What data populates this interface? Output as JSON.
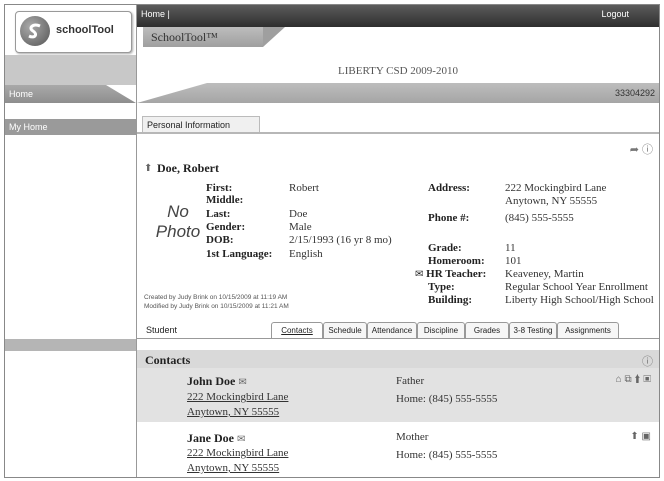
{
  "logo": {
    "text": "schoolTool"
  },
  "topbar": {
    "home": "Home |",
    "logout": "Logout"
  },
  "app_tab": "SchoolTool™",
  "district": "LIBERTY CSD 2009-2010",
  "id_number": "33304292",
  "left_nav": {
    "home_tab": "Home",
    "my_home": "My Home"
  },
  "personal_info_tab": "Personal Information",
  "student": {
    "display_name": "Doe, Robert",
    "no_photo": [
      "No",
      "Photo"
    ],
    "fields": [
      {
        "label": "First:",
        "value": "Robert"
      },
      {
        "label": "Middle:",
        "value": ""
      },
      {
        "label": "Last:",
        "value": "Doe"
      },
      {
        "label": "Gender:",
        "value": "Male"
      },
      {
        "label": "DOB:",
        "value": "2/15/1993 (16 yr 8 mo)"
      },
      {
        "label": "1st Language:",
        "value": "English"
      }
    ],
    "address_label": "Address:",
    "address_line1": "222 Mockingbird Lane",
    "address_line2": "Anytown, NY 55555",
    "phone_label": "Phone #:",
    "phone": "(845) 555-5555",
    "grade_label": "Grade:",
    "grade": "11",
    "homeroom_label": "Homeroom:",
    "homeroom": "101",
    "hr_teacher_label": "HR Teacher:",
    "hr_teacher": "Keaveney, Martin",
    "type_label": "Type:",
    "type": "Regular School Year Enrollment",
    "building_label": "Building:",
    "building": "Liberty High School/High School",
    "created": "Created by Judy Brink on 10/15/2009 at 11:19 AM",
    "modified": "Modified by Judy Brink on 10/15/2009 at 11:21 AM"
  },
  "student_label": "Student",
  "tabs": [
    "Contacts",
    "Schedule",
    "Attendance",
    "Discipline",
    "Grades",
    "3-8 Testing",
    "Assignments"
  ],
  "contacts": {
    "title": "Contacts",
    "items": [
      {
        "name": "John  Doe",
        "address1": "222 Mockingbird Lane",
        "address2": "Anytown, NY 55555",
        "relation": "Father",
        "phone": "Home: (845) 555-5555"
      },
      {
        "name": "Jane  Doe",
        "address1": "222 Mockingbird Lane",
        "address2": "Anytown, NY 55555",
        "relation": "Mother",
        "phone": "Home: (845) 555-5555"
      }
    ]
  }
}
